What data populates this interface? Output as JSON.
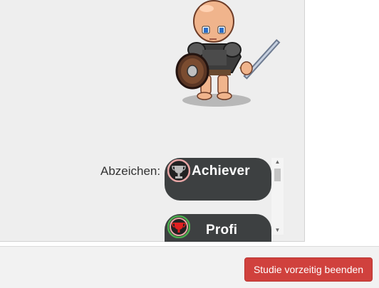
{
  "profile": {
    "avatar_icon": "pixel-knight-avatar-icon",
    "badges_label": "Abzeichen:"
  },
  "badges": [
    {
      "label": "Achiever",
      "icon": "trophy-icon",
      "icon_color": "#bbbbbb",
      "ring_color": "#e8a6a6"
    },
    {
      "label": "Profi",
      "icon": "trophy-icon",
      "icon_color": "#e02020",
      "ring_color": "#4caf50"
    }
  ],
  "footer": {
    "end_study_label": "Studie vorzeitig beenden"
  },
  "colors": {
    "panel_bg": "#eeeeee",
    "badge_bg": "#3d4041",
    "danger": "#d0413d"
  }
}
